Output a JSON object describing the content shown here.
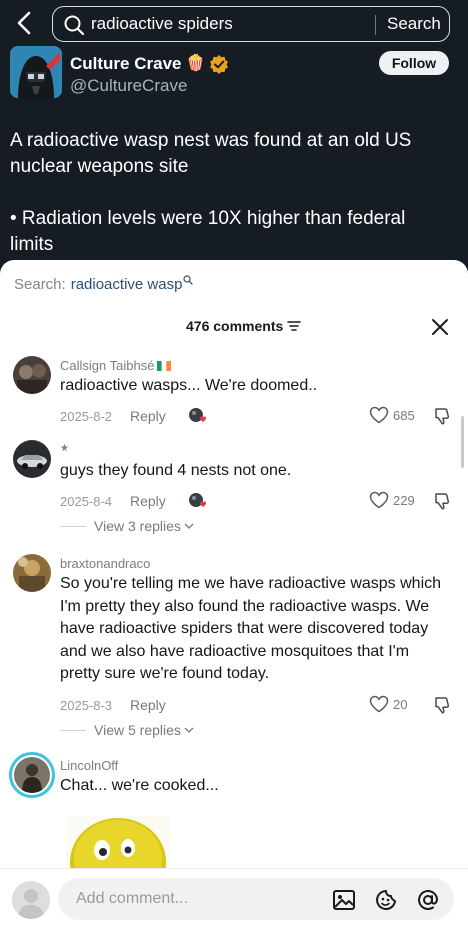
{
  "search": {
    "query": "radioactive spiders",
    "button": "Search"
  },
  "post": {
    "author_name": "Culture Crave",
    "author_emoji": "🍿",
    "handle": "@CultureCrave",
    "follow_label": "Follow",
    "text_line1": "A radioactive wasp nest was found at an old US nuclear weapons site",
    "text_line2": "• Radiation levels were 10X higher than federal limits"
  },
  "sheet": {
    "related_prefix": "Search:",
    "related_term": "radioactive wasp",
    "comments_count": "476 comments"
  },
  "comments": [
    {
      "user": "Callsign Taibhsé",
      "text": "radioactive wasps... We're doomed..",
      "date": "2025-8-2",
      "reply": "Reply",
      "likes": "685",
      "view_replies": ""
    },
    {
      "user": "★",
      "text": "guys they found 4 nests not one.",
      "date": "2025-8-4",
      "reply": "Reply",
      "likes": "229",
      "view_replies": "View 3 replies"
    },
    {
      "user": "braxtonandraco",
      "text": "So you're telling me we have radioactive wasps which I'm pretty they also found the radioactive wasps. We have radioactive spiders that were discovered today and we also have radioactive mosquitoes that I'm pretty sure we're found today.",
      "date": "2025-8-3",
      "reply": "Reply",
      "likes": "20",
      "view_replies": "View 5 replies"
    },
    {
      "user": "LincolnOff",
      "text": "Chat... we're cooked..."
    }
  ],
  "input": {
    "placeholder": "Add comment..."
  },
  "colors": {
    "dark_bg": "#151c24",
    "link_blue": "#2c4f7a",
    "verified_gold": "#e9a21b",
    "liked_red": "#e8384f"
  },
  "icons": [
    "back-arrow-icon",
    "search-icon",
    "verified-badge-icon",
    "filter-icon",
    "close-icon",
    "heart-icon",
    "dislike-icon",
    "chevron-down-icon",
    "image-icon",
    "emoji-icon",
    "mention-icon"
  ]
}
